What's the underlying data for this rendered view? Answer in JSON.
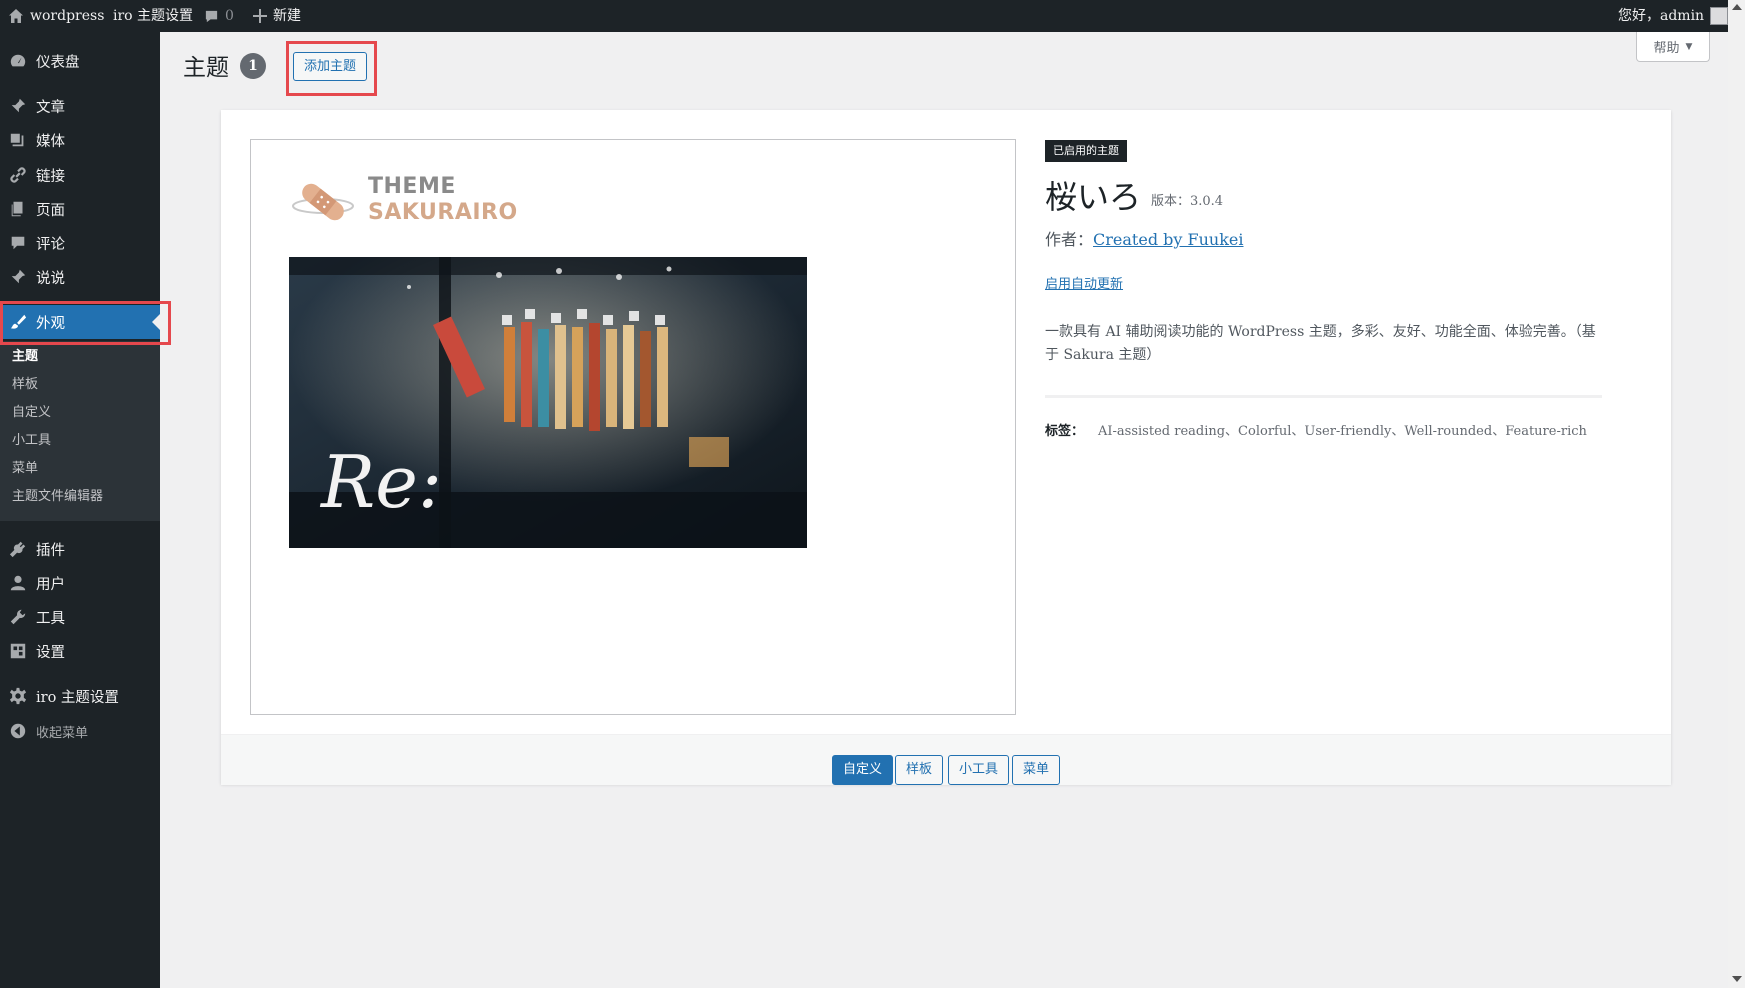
{
  "admin_bar": {
    "site_name": "wordpress",
    "theme_settings": "iro 主题设置",
    "comment_count": "0",
    "new_label": "新建",
    "greeting": "您好，admin"
  },
  "sidebar": {
    "items": [
      {
        "label": "仪表盘",
        "icon": "dashboard-icon"
      },
      {
        "label": "文章",
        "icon": "pin-icon"
      },
      {
        "label": "媒体",
        "icon": "media-icon"
      },
      {
        "label": "链接",
        "icon": "link-icon"
      },
      {
        "label": "页面",
        "icon": "page-icon"
      },
      {
        "label": "评论",
        "icon": "comment-icon"
      },
      {
        "label": "说说",
        "icon": "pin-icon"
      },
      {
        "label": "外观",
        "icon": "paintbrush-icon"
      },
      {
        "label": "插件",
        "icon": "plugin-icon"
      },
      {
        "label": "用户",
        "icon": "user-icon"
      },
      {
        "label": "工具",
        "icon": "wrench-icon"
      },
      {
        "label": "设置",
        "icon": "settings-icon"
      },
      {
        "label": "iro 主题设置",
        "icon": "gear-icon"
      },
      {
        "label": "收起菜单",
        "icon": "collapse-icon"
      }
    ],
    "submenu": [
      "主题",
      "样板",
      "自定义",
      "小工具",
      "菜单",
      "主题文件编辑器"
    ]
  },
  "header": {
    "title": "主题",
    "count": "1",
    "add_button": "添加主题",
    "help": "帮助"
  },
  "theme": {
    "badge": "已启用的主题",
    "name": "桜いろ",
    "version": "版本：3.0.4",
    "author_prefix": "作者：",
    "author": "Created by Fuukei",
    "auto_update": "启用自动更新",
    "description": "一款具有 AI 辅助阅读功能的 WordPress 主题，多彩、友好、功能全面、体验完善。（基于 Sakura 主题）",
    "tags_label": "标签：",
    "tags": "AI-assisted reading、Colorful、User-friendly、Well-rounded、Feature-rich",
    "screenshot": {
      "logo_line1": "THEME",
      "logo_line2": "SAKURAIRO",
      "photo_text": "Re:"
    }
  },
  "actions": {
    "customize": "自定义",
    "patterns": "样板",
    "widgets": "小工具",
    "menus": "菜单"
  },
  "colors": {
    "admin_dark": "#1d2327",
    "accent": "#2271b1",
    "highlight": "#e5484d"
  }
}
